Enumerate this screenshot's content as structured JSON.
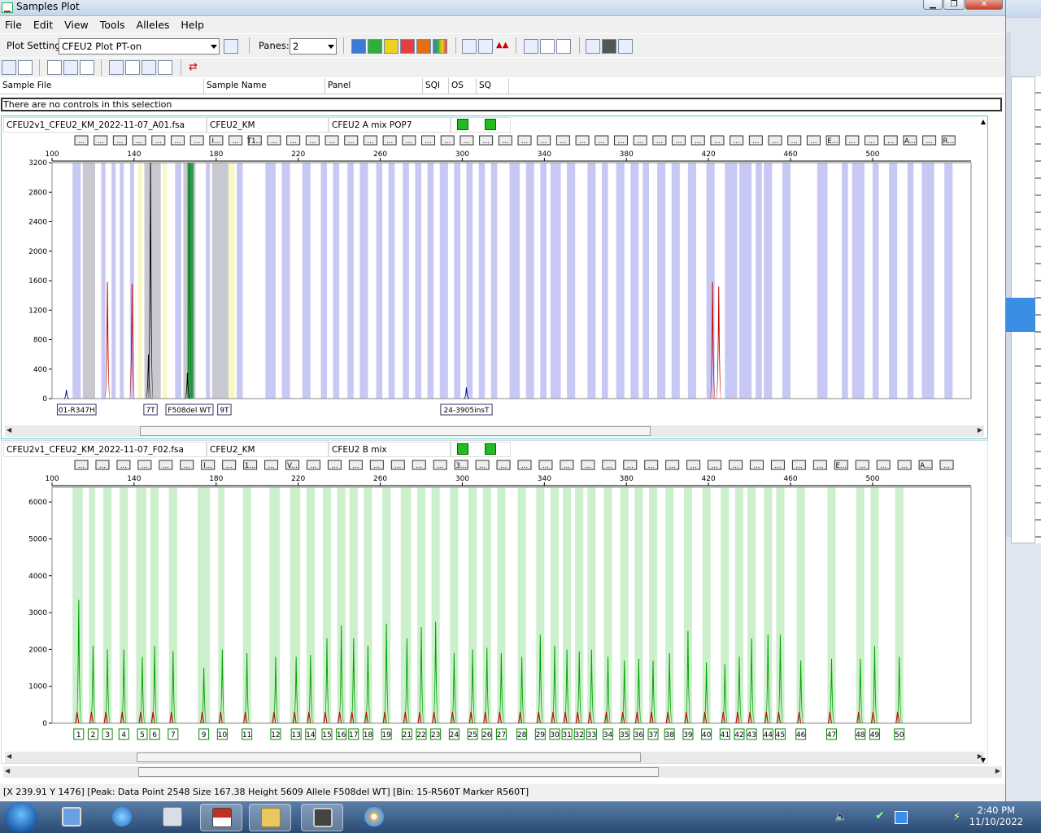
{
  "window": {
    "title": "Samples Plot"
  },
  "menu": [
    "File",
    "Edit",
    "View",
    "Tools",
    "Alleles",
    "Help"
  ],
  "toolbar": {
    "plot_setting_label": "Plot Setting:",
    "plot_setting_value": "CFEU2 Plot PT-on",
    "panes_label": "Panes:",
    "panes_value": "2"
  },
  "sample_grid": {
    "columns": [
      "Sample File",
      "Sample Name",
      "Panel",
      "SQI",
      "OS",
      "SQ"
    ],
    "message": "There are no controls in this selection"
  },
  "pane1": {
    "sample_file": "CFEU2v1_CFEU2_KM_2022-11-07_A01.fsa",
    "sample_name": "CFEU2_KM",
    "panel": "CFEU2 A mix POP7",
    "x_ticks": [
      100,
      140,
      180,
      220,
      260,
      300,
      340,
      380,
      420,
      460,
      500
    ],
    "y_ticks": [
      0,
      400,
      800,
      1200,
      1600,
      2000,
      2400,
      2800,
      3200
    ],
    "x_range": [
      100,
      548
    ],
    "y_range": [
      0,
      3200
    ],
    "bin_labels": [
      "...",
      "...",
      "...",
      "...",
      "...",
      "...",
      "...",
      "I...",
      "...",
      "T1...",
      "...",
      "...",
      "...",
      "...",
      "...",
      "...",
      "...",
      "...",
      "...",
      "...",
      "...",
      "...",
      "...",
      "...",
      "...",
      "...",
      "...",
      "...",
      "...",
      "...",
      "...",
      "...",
      "...",
      "...",
      "...",
      "...",
      "...",
      "...",
      "...",
      "E...",
      "...",
      "...",
      "...",
      "A...",
      "...",
      "R..."
    ],
    "allele_calls": [
      {
        "label": "01-R347H",
        "x": 112
      },
      {
        "label": "7T",
        "x": 148
      },
      {
        "label": "F508del WT",
        "x": 167
      },
      {
        "label": "9T",
        "x": 184
      },
      {
        "label": "24-3905insT",
        "x": 302
      }
    ],
    "peaks": [
      {
        "x": 107,
        "h": 120,
        "color": "#000080"
      },
      {
        "x": 127,
        "h": 1580,
        "color": "#c00000"
      },
      {
        "x": 139,
        "h": 1560,
        "color": "#c00000"
      },
      {
        "x": 148,
        "h": 3200,
        "color": "#000000"
      },
      {
        "x": 147,
        "h": 600,
        "color": "#000000"
      },
      {
        "x": 167,
        "h": 3200,
        "color": "#008000"
      },
      {
        "x": 166,
        "h": 350,
        "color": "#000000"
      },
      {
        "x": 302,
        "h": 150,
        "color": "#000080"
      },
      {
        "x": 422,
        "h": 1580,
        "color": "#c00000"
      },
      {
        "x": 425,
        "h": 1520,
        "color": "#c00000"
      }
    ]
  },
  "pane2": {
    "sample_file": "CFEU2v1_CFEU2_KM_2022-11-07_F02.fsa",
    "sample_name": "CFEU2_KM",
    "panel": "CFEU2 B mix",
    "x_ticks": [
      100,
      140,
      180,
      220,
      260,
      300,
      340,
      380,
      420,
      460,
      500
    ],
    "y_ticks": [
      0,
      1000,
      2000,
      3000,
      4000,
      5000,
      6000
    ],
    "x_range": [
      100,
      548
    ],
    "y_range": [
      0,
      6400
    ],
    "bin_labels": [
      "...",
      "...",
      "...",
      "...",
      "...",
      "...",
      "I...",
      "...",
      "1...",
      "...",
      "V...",
      "...",
      "...",
      "...",
      "...",
      "...",
      "...",
      "...",
      "3...",
      "...",
      "...",
      "...",
      "...",
      "...",
      "...",
      "...",
      "...",
      "...",
      "...",
      "...",
      "...",
      "...",
      "...",
      "...",
      "...",
      "...",
      "E...",
      "...",
      "...",
      "...",
      "A...",
      "..."
    ],
    "peaks": [
      {
        "n": 1,
        "x": 113,
        "h": 3350
      },
      {
        "n": 2,
        "x": 120,
        "h": 2100
      },
      {
        "n": 3,
        "x": 127,
        "h": 2000
      },
      {
        "n": 4,
        "x": 135,
        "h": 2000
      },
      {
        "n": 5,
        "x": 144,
        "h": 1800
      },
      {
        "n": 6,
        "x": 150,
        "h": 2100
      },
      {
        "n": 7,
        "x": 159,
        "h": 1950
      },
      {
        "n": 9,
        "x": 174,
        "h": 1500
      },
      {
        "n": 10,
        "x": 183,
        "h": 2000
      },
      {
        "n": 11,
        "x": 195,
        "h": 1900
      },
      {
        "n": 12,
        "x": 209,
        "h": 1800
      },
      {
        "n": 13,
        "x": 219,
        "h": 1800
      },
      {
        "n": 14,
        "x": 226,
        "h": 1850
      },
      {
        "n": 15,
        "x": 234,
        "h": 2300
      },
      {
        "n": 16,
        "x": 241,
        "h": 2650
      },
      {
        "n": 17,
        "x": 247,
        "h": 2300
      },
      {
        "n": 18,
        "x": 254,
        "h": 2100
      },
      {
        "n": 19,
        "x": 263,
        "h": 2700
      },
      {
        "n": 21,
        "x": 273,
        "h": 2300
      },
      {
        "n": 22,
        "x": 280,
        "h": 2600
      },
      {
        "n": 23,
        "x": 287,
        "h": 2750
      },
      {
        "n": 24,
        "x": 296,
        "h": 1900
      },
      {
        "n": 25,
        "x": 305,
        "h": 2000
      },
      {
        "n": 26,
        "x": 312,
        "h": 2050
      },
      {
        "n": 27,
        "x": 319,
        "h": 1900
      },
      {
        "n": 28,
        "x": 329,
        "h": 1800
      },
      {
        "n": 29,
        "x": 338,
        "h": 2400
      },
      {
        "n": 30,
        "x": 345,
        "h": 2100
      },
      {
        "n": 31,
        "x": 351,
        "h": 2000
      },
      {
        "n": 32,
        "x": 357,
        "h": 1950
      },
      {
        "n": 33,
        "x": 363,
        "h": 2000
      },
      {
        "n": 34,
        "x": 371,
        "h": 1800
      },
      {
        "n": 35,
        "x": 379,
        "h": 1700
      },
      {
        "n": 36,
        "x": 386,
        "h": 1750
      },
      {
        "n": 37,
        "x": 393,
        "h": 1700
      },
      {
        "n": 38,
        "x": 401,
        "h": 1900
      },
      {
        "n": 39,
        "x": 410,
        "h": 2500
      },
      {
        "n": 40,
        "x": 419,
        "h": 1650
      },
      {
        "n": 41,
        "x": 428,
        "h": 1600
      },
      {
        "n": 42,
        "x": 435,
        "h": 1800
      },
      {
        "n": 43,
        "x": 441,
        "h": 2300
      },
      {
        "n": 44,
        "x": 449,
        "h": 2400
      },
      {
        "n": 45,
        "x": 455,
        "h": 2400
      },
      {
        "n": 46,
        "x": 465,
        "h": 1700
      },
      {
        "n": 47,
        "x": 480,
        "h": 1750
      },
      {
        "n": 48,
        "x": 494,
        "h": 1750
      },
      {
        "n": 49,
        "x": 501,
        "h": 2100
      },
      {
        "n": 50,
        "x": 513,
        "h": 1800
      }
    ]
  },
  "status": "[X 239.91  Y 1476]  [Peak: Data Point 2548  Size 167.38  Height 5609  Allele F508del WT]  [Bin: 15-R560T Marker R560T]",
  "clock": {
    "time": "2:40 PM",
    "date": "11/10/2022"
  },
  "colors": {
    "bin_blue": "#c8c8f4",
    "bin_green": "#ccefcc",
    "bin_grey": "#c8c8d0",
    "bin_yellow": "#f8f8c0",
    "pane_border": "#5cc"
  }
}
